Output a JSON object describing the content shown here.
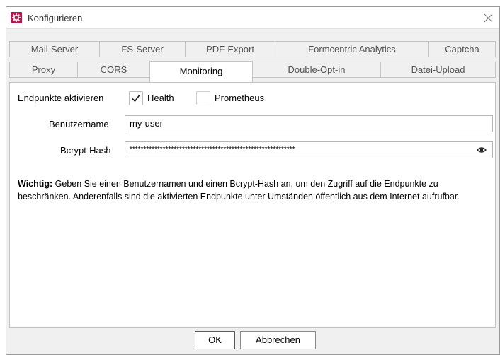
{
  "window": {
    "title": "Konfigurieren"
  },
  "tabs_row1": [
    {
      "label": "Mail-Server"
    },
    {
      "label": "FS-Server"
    },
    {
      "label": "PDF-Export"
    },
    {
      "label": "Formcentric Analytics"
    },
    {
      "label": "Captcha"
    }
  ],
  "tabs_row2": [
    {
      "label": "Proxy"
    },
    {
      "label": "CORS"
    },
    {
      "label": "Monitoring",
      "active": true
    },
    {
      "label": "Double-Opt-in"
    },
    {
      "label": "Datei-Upload"
    }
  ],
  "endpoints": {
    "label": "Endpunkte aktivieren",
    "health": {
      "label": "Health",
      "checked": true
    },
    "prometheus": {
      "label": "Prometheus",
      "checked": false
    }
  },
  "username": {
    "label": "Benutzername",
    "value": "my-user"
  },
  "hash": {
    "label": "Bcrypt-Hash",
    "value": "************************************************************"
  },
  "note": {
    "bold": "Wichtig:",
    "text": " Geben Sie einen Benutzernamen und einen Bcrypt-Hash an, um den Zugriff auf die Endpunkte zu beschränken. Anderenfalls sind die aktivierten Endpunkte unter Umständen öffentlich aus dem Internet aufrufbar."
  },
  "buttons": {
    "ok": "OK",
    "cancel": "Abbrechen"
  },
  "colors": {
    "brand": "#b01b4b"
  },
  "icons": [
    "app-logo-icon",
    "close-icon",
    "checkmark-icon",
    "eye-icon"
  ]
}
